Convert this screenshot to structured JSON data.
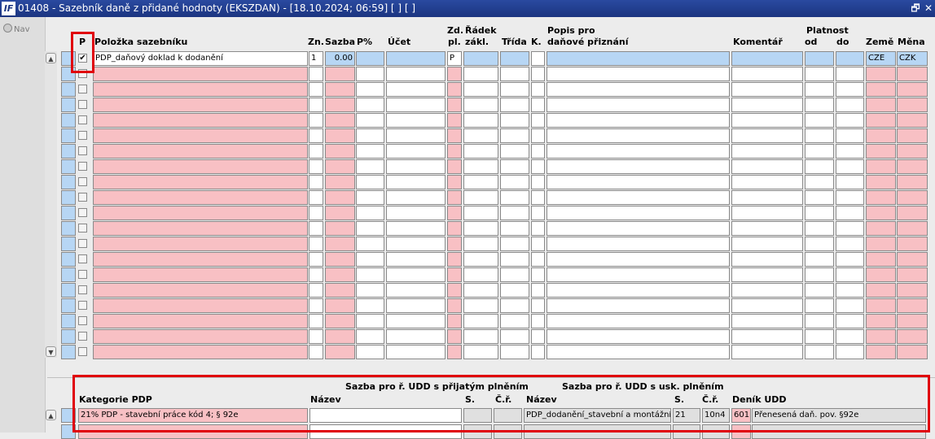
{
  "window": {
    "title": "01408 - Sazebník daně z přidané hodnoty (EKSZDAN) - [18.10.2024; 06:59]  [ ]  [ ]",
    "logo": "IF",
    "restore_glyph": "🗗",
    "close_glyph": "✕"
  },
  "nav": {
    "label": "Nav"
  },
  "main_table": {
    "headers": {
      "p": "P",
      "polozka": "Položka sazebníku",
      "zn": "Zn.",
      "sazba": "Sazba",
      "p_pct": "P%",
      "ucet": "Účet",
      "zd_top": "Zd.",
      "zd_bottom": "pl.",
      "radek_top": "Řádek",
      "radek_bottom": "zákl.",
      "trida": "Třída",
      "k": "K.",
      "popis_top": "Popis pro",
      "popis_bottom": "daňové přiznání",
      "komentar": "Komentář",
      "platnost": "Platnost",
      "od": "od",
      "do": "do",
      "zeme": "Země",
      "mena": "Měna"
    },
    "row1": {
      "checked_glyph": "✔",
      "polozka": "PDP_daňový doklad k dodanění",
      "zn": "1",
      "sazba": "0.00",
      "zd": "P",
      "zeme": "CZE",
      "mena": "CZK"
    }
  },
  "bottom_table": {
    "headers": {
      "group1": "Sazba pro ř. UDD s přijatým plněním",
      "group2": "Sazba pro ř. UDD s usk. plněním",
      "kategorie": "Kategorie PDP",
      "nazev1": "Název",
      "s1": "S.",
      "cr1": "Č.ř.",
      "nazev2": "Název",
      "s2": "S.",
      "cr2": "Č.ř.",
      "denik": "Deník UDD"
    },
    "row1": {
      "kategorie": "21% PDP - stavební práce kód 4; § 92e",
      "nazev2": "PDP_dodanění_stavební a montážní p",
      "s2": "21",
      "cr2": "10n4",
      "denik_code": "601",
      "denik_name": "Přenesená daň. pov. §92e"
    }
  }
}
